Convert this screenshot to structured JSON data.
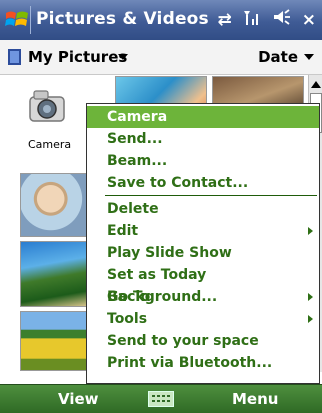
{
  "window": {
    "title": "Pictures & Videos"
  },
  "status": {
    "connectivity_icon": "data-sync-icon",
    "signal_icon": "signal-strength-icon",
    "volume_icon": "speaker-icon",
    "close_label": "×"
  },
  "folder": {
    "label": "My Pictures",
    "sort_label": "Date"
  },
  "items": [
    {
      "label": "Camera",
      "icon": "camera-icon"
    }
  ],
  "menu": {
    "items": [
      {
        "label": "Camera",
        "selected": true
      },
      {
        "label": "Send..."
      },
      {
        "label": "Beam..."
      },
      {
        "label": "Save to Contact..."
      },
      {
        "label": "Delete"
      },
      {
        "label": "Edit",
        "submenu": true
      },
      {
        "label": "Play Slide Show"
      },
      {
        "label": "Set as Today Background..."
      },
      {
        "label": "Go To",
        "submenu": true
      },
      {
        "label": "Tools",
        "submenu": true
      },
      {
        "label": "Send to your space"
      },
      {
        "label": "Print via Bluetooth..."
      }
    ]
  },
  "softkeys": {
    "left": "View",
    "right": "Menu"
  },
  "colors": {
    "menu_text": "#2f6f16",
    "menu_selected_bg": "#6db43a",
    "title_bar": "#3f5b95",
    "softkey_bar": "#2f6a25"
  }
}
